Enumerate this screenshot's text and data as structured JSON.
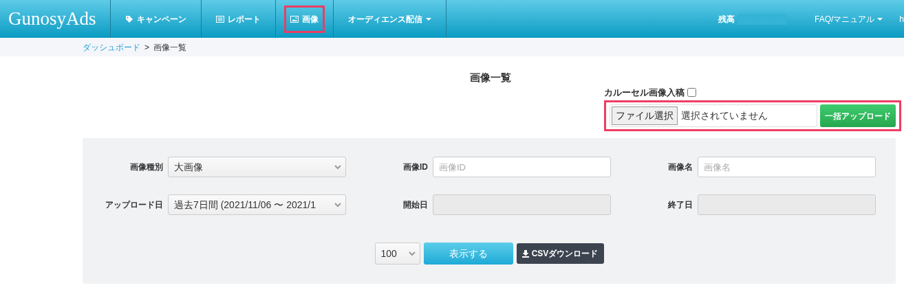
{
  "navbar": {
    "logo": "GunosyAds",
    "items": [
      {
        "label": "キャンペーン",
        "kind": "tag",
        "dropdown": false,
        "highlighted": false
      },
      {
        "label": "レポート",
        "kind": "report",
        "dropdown": false,
        "highlighted": false
      },
      {
        "label": "画像",
        "kind": "image",
        "dropdown": false,
        "highlighted": true
      },
      {
        "label": "オーディエンス配信",
        "kind": "plain",
        "dropdown": true,
        "highlighted": false
      }
    ],
    "right_items": [
      {
        "kind": "balance",
        "label": "残高"
      },
      {
        "kind": "menu",
        "label": "FAQ/マニュアル",
        "dropdown": true
      },
      {
        "kind": "menu",
        "label": "h",
        "dropdown": false
      }
    ]
  },
  "breadcrumb": [
    {
      "label": "ダッシュボード",
      "link": true
    },
    {
      "label": ">",
      "link": false
    },
    {
      "label": "画像一覧",
      "link": false
    }
  ],
  "page_title": "画像一覧",
  "upload": {
    "carousel_label": "カルーセル画像入稿",
    "carousel_checked": false,
    "file_button": "ファイル選択",
    "file_status": "選択されていません",
    "upload_button": "一括アップロード",
    "highlighted": true
  },
  "filters": [
    {
      "label": "画像種別",
      "kind": "select",
      "value": "大画像"
    },
    {
      "label": "画像ID",
      "kind": "input",
      "placeholder": "画像ID",
      "disabled": false
    },
    {
      "label": "画像名",
      "kind": "input",
      "placeholder": "画像名",
      "disabled": false
    },
    {
      "label": "アップロード日",
      "kind": "select",
      "value": "過去7日間 (2021/11/06 〜 2021/1"
    },
    {
      "label": "開始日",
      "kind": "input",
      "disabled": true
    },
    {
      "label": "終了日",
      "kind": "input",
      "disabled": true
    }
  ],
  "actions": {
    "per_page": "100",
    "show_button": "表示する",
    "csv_button": "CSVダウンロード"
  }
}
